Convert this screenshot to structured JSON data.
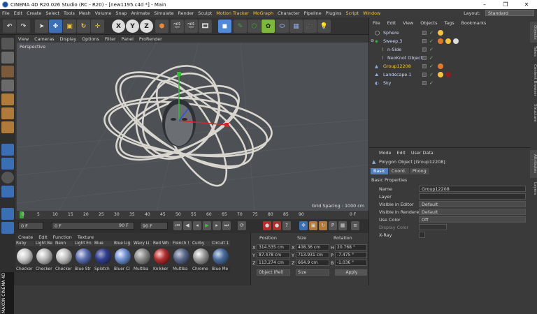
{
  "window": {
    "title": "CINEMA 4D R20.026 Studio (RC - R20) - [new1195.c4d *] - Main",
    "controls": [
      "–",
      "❐",
      "✕"
    ]
  },
  "menu": {
    "items": [
      "File",
      "Edit",
      "Create",
      "Select",
      "Tools",
      "Mesh",
      "Volume",
      "Snap",
      "Animate",
      "Simulate",
      "Render",
      "Sculpt",
      "Motion Tracker",
      "MoGraph",
      "Character",
      "Pipeline",
      "Plugins",
      "Script",
      "Window"
    ],
    "layout_label": "Layout:",
    "layout_value": "Standard"
  },
  "toolbar": {
    "axis_x": "X",
    "axis_y": "Y",
    "axis_z": "Z"
  },
  "viewport": {
    "menu": [
      "View",
      "Cameras",
      "Display",
      "Options",
      "Filter",
      "Panel",
      "ProRender"
    ],
    "label": "Perspective",
    "grid_spacing": "Grid Spacing : 1000 cm"
  },
  "timeline": {
    "ticks": [
      "0",
      "5",
      "10",
      "15",
      "20",
      "25",
      "30",
      "35",
      "40",
      "45",
      "50",
      "55",
      "60",
      "65",
      "70",
      "75",
      "80",
      "85",
      "90"
    ],
    "end_label": "0 F",
    "start_frame": "0 F",
    "field2": "0 F",
    "max_frame": "90 F",
    "end_frame": "90 F"
  },
  "materials": {
    "menu": [
      "Create",
      "Edit",
      "Function",
      "Texture"
    ],
    "items": [
      {
        "name": "Ruby",
        "sub": "Checker",
        "color": "#c9c9c9"
      },
      {
        "name": "Light Be",
        "sub": "Checker",
        "color": "#b9b9b9"
      },
      {
        "name": "Neon",
        "sub": "Checker",
        "color": "#bfbfbf"
      },
      {
        "name": "Light En",
        "sub": "Blue Str",
        "color": "#5a6fb0"
      },
      {
        "name": "Blue",
        "sub": "Splotch",
        "color": "#2f3f8f"
      },
      {
        "name": "Blue Lig",
        "sub": "Bluer Cl",
        "color": "#6f8fd0"
      },
      {
        "name": "Wavy Li",
        "sub": "Multiba",
        "color": "#8a8a8a"
      },
      {
        "name": "Red Wh",
        "sub": "Knikker",
        "color": "#b03030"
      },
      {
        "name": "French !",
        "sub": "Multiba",
        "color": "#5a6a8a"
      },
      {
        "name": "Curby",
        "sub": "Chrome",
        "color": "#9a9a9a"
      },
      {
        "name": "Circuit 1",
        "sub": "Blue Me",
        "color": "#4a6a9a"
      }
    ]
  },
  "coords": {
    "headers": [
      "Position",
      "Size",
      "Rotation"
    ],
    "rows": [
      {
        "axis": "X",
        "pos": "314.535 cm",
        "size_axis": "X",
        "size": "408.36 cm",
        "rot_axis": "H",
        "rot": "20.768 °"
      },
      {
        "axis": "Y",
        "pos": "87.478 cm",
        "size_axis": "Y",
        "size": "713.931 cm",
        "rot_axis": "P",
        "rot": "-7.475 °"
      },
      {
        "axis": "Z",
        "pos": "113.274 cm",
        "size_axis": "Z",
        "size": "664.9 cm",
        "rot_axis": "B",
        "rot": "-1.036 °"
      }
    ],
    "mode": "Object (Rel)",
    "size_mode": "Size",
    "apply": "Apply"
  },
  "objects": {
    "tabs": [
      "File",
      "Edit",
      "View",
      "Objects",
      "Tags",
      "Bookmarks"
    ],
    "items": [
      {
        "name": "Sphere",
        "indent": 0,
        "color": "#cdd8ff"
      },
      {
        "name": "Sweep.3",
        "indent": 0,
        "color": "#cdd8ff"
      },
      {
        "name": "n-Side",
        "indent": 1,
        "color": "#cdd8ff"
      },
      {
        "name": "NeoKnot Object",
        "indent": 1,
        "color": "#cdd8ff"
      },
      {
        "name": "Group12208",
        "indent": 0,
        "color": "#f4c343"
      },
      {
        "name": "Landscape.1",
        "indent": 0,
        "color": "#cdd8ff"
      },
      {
        "name": "Sky",
        "indent": 0,
        "color": "#cdd8ff"
      }
    ]
  },
  "side_tabs": [
    "Objects",
    "Takes",
    "Content Browser",
    "Structure",
    "Attributes",
    "Layers"
  ],
  "attributes": {
    "menu": [
      "Mode",
      "Edit",
      "User Data"
    ],
    "title": "Polygon Object [Group12208]",
    "tabs": [
      "Basic",
      "Coord.",
      "Phong"
    ],
    "section": "Basic Properties",
    "rows": [
      {
        "label": "Name",
        "value": "Group12208"
      },
      {
        "label": "Layer",
        "value": ""
      },
      {
        "label": "Visible in Editor",
        "value": "Default"
      },
      {
        "label": "Visible in Renderer",
        "value": "Default"
      },
      {
        "label": "Use Color",
        "value": "Off"
      },
      {
        "label": "Display Color",
        "value": ""
      },
      {
        "label": "X-Ray",
        "value": ""
      }
    ]
  }
}
